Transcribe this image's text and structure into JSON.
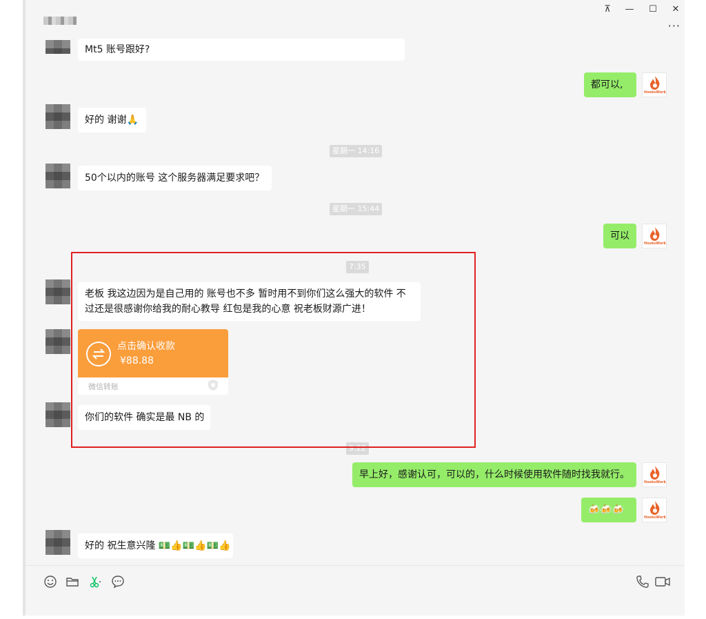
{
  "window": {
    "controls": {
      "pin": "⊼",
      "minimize": "—",
      "maximize": "☐",
      "close": "✕",
      "more": "···"
    }
  },
  "brand_avatar_text": "HooksWork",
  "messages": [
    {
      "side": "in",
      "text": "Mt5 账号跟好?"
    },
    {
      "side": "out",
      "text": "都可以,"
    },
    {
      "side": "in",
      "text": "好的 谢谢🙏"
    },
    {
      "side": "time",
      "text": "星期一 14:16"
    },
    {
      "side": "in",
      "text": "50个以内的账号 这个服务器满足要求吧？"
    },
    {
      "side": "time",
      "text": "星期一 15:44"
    },
    {
      "side": "out",
      "text": "可以"
    },
    {
      "side": "time",
      "text": "7:35"
    },
    {
      "side": "in",
      "text": "老板 我这边因为是自己用的 账号也不多 暂时用不到你们这么强大的软件 不过还是很感谢你给我的耐心教导 红包是我的心意 祝老板财源广进！"
    },
    {
      "side": "in",
      "type": "transfer"
    },
    {
      "side": "in",
      "text": "你们的软件 确实是最 NB 的"
    },
    {
      "side": "time",
      "text": "9:22"
    },
    {
      "side": "out",
      "text": "早上好，感谢认可，可以的，什么时候使用软件随时找我就行。"
    },
    {
      "side": "out",
      "text": "🍻🍻🍻"
    },
    {
      "side": "in",
      "text": "好的 祝生意兴隆 💵👍💵👍💵👍"
    }
  ],
  "transfer": {
    "title": "点击确认收款",
    "amount": "¥88.88",
    "footer": "微信转账",
    "color": "#fa9d3b"
  },
  "toolbar": {
    "icons": [
      "emoji-icon",
      "folder-icon",
      "scissors-icon",
      "chat-icon",
      "phone-icon",
      "video-icon"
    ]
  },
  "colors": {
    "outgoing_bubble": "#95ec69",
    "incoming_bubble": "#ffffff",
    "highlight_box": "#e02020"
  }
}
